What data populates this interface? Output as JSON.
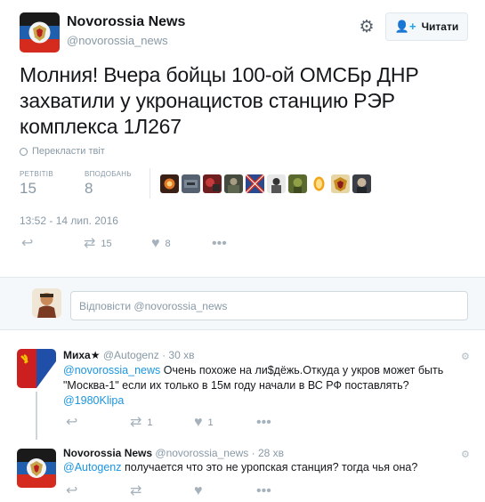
{
  "tweet": {
    "author_name": "Novorossia News",
    "author_handle": "@novorossia_news",
    "follow_label": "Читати",
    "text": "Молния! Вчера бойцы 100-ой ОМСБр ДНР захватили у укронацистов станцию РЭР комплекса 1Л267",
    "translate_label": "Перекласти твіт",
    "retweets_label": "РЕТВІТІВ",
    "retweets_count": "15",
    "likes_label": "ВПОДОБАНЬ",
    "likes_count": "8",
    "timestamp": "13:52 - 14 лип. 2016",
    "action_retweet_count": "15",
    "action_like_count": "8"
  },
  "reply_box": {
    "placeholder": "Відповісти @novorossia_news"
  },
  "replies": [
    {
      "name": "Миха★",
      "handle": "@Autogenz",
      "time": "30 хв",
      "mention": "@novorossia_news",
      "text": "Очень похоже на ли$дёжь.Откуда у укров может быть \"Москва-1\" если их только в 15м году начали в ВС РФ поставлять?",
      "mention2": "@1980Klipa",
      "retweets": "1",
      "likes": "1"
    },
    {
      "name": "Novorossia News",
      "handle": "@novorossia_news",
      "time": "28 хв",
      "mention": "@Autogenz",
      "text": "получается что это не уропская станция? тогда чья она?"
    }
  ],
  "icons": {
    "gear": "gear-icon",
    "follow": "add-user-icon",
    "reply": "reply-icon",
    "retweet": "retweet-icon",
    "like": "heart-icon",
    "more": "more-icon"
  },
  "colors": {
    "link": "#1b95e0",
    "muted": "#8899a6",
    "accent": "#1da1f2"
  }
}
